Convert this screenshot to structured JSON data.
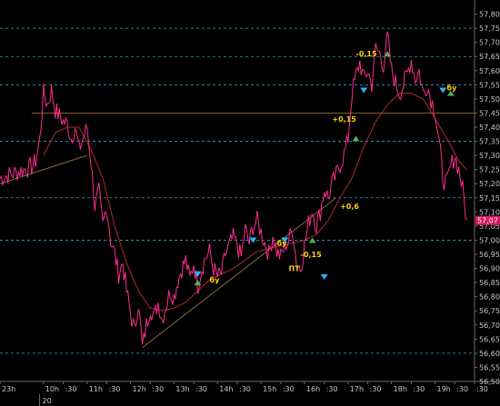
{
  "chart_data": {
    "type": "line",
    "title": "",
    "xlabel": "",
    "ylabel": "",
    "ylim": [
      56.5,
      57.85
    ],
    "grid": true,
    "y_ticks": [
      "57,80",
      "57,75",
      "57,70",
      "57,65",
      "57,60",
      "57,55",
      "57,50",
      "57,45",
      "57,40",
      "57,35",
      "57,30",
      "57,25",
      "57,20",
      "57,15",
      "57,10",
      "57,05",
      "57,00",
      "56,95",
      "56,90",
      "56,85",
      "56,80",
      "56,75",
      "56,70",
      "56,65",
      "56,60",
      "56,55",
      "56,50"
    ],
    "x_ticks": [
      {
        "label": "23h",
        "t": 0
      },
      {
        "label": "10h",
        "t": 11
      },
      {
        "label": ":30",
        "t": 16
      },
      {
        "label": "11h",
        "t": 22
      },
      {
        "label": ":30",
        "t": 27
      },
      {
        "label": "12h",
        "t": 33
      },
      {
        "label": ":30",
        "t": 38
      },
      {
        "label": "13h",
        "t": 44
      },
      {
        "label": ":30",
        "t": 49
      },
      {
        "label": "14h",
        "t": 55
      },
      {
        "label": ":30",
        "t": 60
      },
      {
        "label": "15h",
        "t": 66
      },
      {
        "label": ":30",
        "t": 71
      },
      {
        "label": "16h",
        "t": 77
      },
      {
        "label": ":30",
        "t": 82
      },
      {
        "label": "17h",
        "t": 88
      },
      {
        "label": ":30",
        "t": 93
      },
      {
        "label": "18h",
        "t": 99
      },
      {
        "label": ":30",
        "t": 104
      },
      {
        "label": "19h",
        "t": 110
      },
      {
        "label": ":30",
        "t": 115
      },
      {
        "label": ":30",
        "t": 120
      }
    ],
    "date_label": "20",
    "hlines": [
      57.75,
      57.65,
      57.55,
      57.35,
      57.15,
      57.0,
      56.6
    ],
    "level_line": 57.45,
    "price_series": {
      "t": [
        0,
        2,
        4,
        6,
        8,
        9,
        10,
        11,
        12,
        13,
        14,
        15,
        16,
        17,
        18,
        19,
        20,
        21,
        22,
        23,
        24,
        25,
        26,
        27,
        28,
        29,
        30,
        31,
        32,
        33,
        34,
        35,
        36,
        37,
        38,
        39,
        40,
        41,
        42,
        43,
        44,
        45,
        46,
        47,
        48,
        49,
        50,
        51,
        52,
        53,
        54,
        55,
        56,
        57,
        58,
        59,
        60,
        61,
        62,
        63,
        64,
        65,
        66,
        67,
        68,
        69,
        70,
        71,
        72,
        73,
        74,
        75,
        76,
        77,
        78,
        79,
        80,
        81,
        82,
        83,
        84,
        85,
        86,
        87,
        88,
        89,
        90,
        91,
        92,
        93,
        94,
        95,
        96,
        97,
        98,
        99,
        100,
        101,
        102,
        103,
        104,
        105,
        106,
        107,
        108,
        109,
        110,
        111,
        112,
        113,
        114,
        115,
        116,
        117,
        118
      ],
      "y": [
        57.22,
        57.23,
        57.24,
        57.25,
        57.26,
        57.28,
        57.35,
        57.52,
        57.48,
        57.53,
        57.46,
        57.44,
        57.42,
        57.41,
        57.36,
        57.4,
        57.32,
        57.36,
        57.4,
        57.28,
        57.12,
        57.17,
        57.05,
        57.12,
        57.0,
        56.95,
        56.88,
        56.92,
        56.82,
        56.74,
        56.68,
        56.78,
        56.62,
        56.7,
        56.76,
        56.73,
        56.78,
        56.72,
        56.77,
        56.82,
        56.8,
        56.86,
        56.9,
        56.93,
        56.86,
        56.92,
        56.84,
        56.9,
        56.94,
        56.96,
        56.9,
        56.87,
        56.88,
        56.95,
        56.98,
        57.01,
        56.98,
        56.94,
        57.04,
        56.99,
        57.05,
        57.07,
        57.03,
        56.99,
        56.95,
        57.02,
        56.96,
        56.94,
        56.98,
        57.0,
        57.04,
        56.92,
        56.9,
        56.98,
        57.06,
        57.11,
        57.05,
        57.1,
        57.18,
        57.15,
        57.2,
        57.23,
        57.27,
        57.3,
        57.36,
        57.52,
        57.58,
        57.63,
        57.57,
        57.6,
        57.55,
        57.68,
        57.66,
        57.62,
        57.72,
        57.6,
        57.56,
        57.52,
        57.55,
        57.59,
        57.64,
        57.57,
        57.6,
        57.52,
        57.55,
        57.5,
        57.46,
        57.35,
        57.22,
        57.2,
        57.26,
        57.3,
        57.25,
        57.18,
        57.07,
        57.03,
        57.0,
        57.05,
        57.07
      ]
    },
    "ma_series": {
      "t": [
        11,
        14,
        17,
        20,
        23,
        26,
        29,
        32,
        35,
        38,
        41,
        44,
        47,
        50,
        53,
        56,
        59,
        62,
        65,
        68,
        71,
        74,
        77,
        80,
        83,
        86,
        89,
        92,
        95,
        98,
        101,
        104,
        107,
        110,
        113,
        116,
        118
      ],
      "y": [
        57.3,
        57.38,
        57.4,
        57.4,
        57.32,
        57.22,
        57.05,
        56.92,
        56.82,
        56.76,
        56.75,
        56.76,
        56.78,
        56.82,
        56.86,
        56.88,
        56.9,
        56.93,
        56.96,
        56.97,
        56.98,
        56.99,
        57.0,
        57.02,
        57.07,
        57.15,
        57.22,
        57.33,
        57.42,
        57.48,
        57.52,
        57.52,
        57.5,
        57.43,
        57.36,
        57.28,
        57.25
      ]
    },
    "trend_lines": [
      {
        "t1": 0,
        "y1": 57.2,
        "t2": 22,
        "y2": 57.3
      },
      {
        "t1": 36,
        "y1": 56.62,
        "t2": 85,
        "y2": 57.15
      }
    ],
    "arrows_up": [
      {
        "t": 50,
        "y": 56.85
      },
      {
        "t": 79,
        "y": 57.0
      },
      {
        "t": 90,
        "y": 57.36
      },
      {
        "t": 98,
        "y": 57.66
      },
      {
        "t": 114,
        "y": 57.52
      }
    ],
    "arrows_down": [
      {
        "t": 50,
        "y": 56.88
      },
      {
        "t": 64,
        "y": 57.0
      },
      {
        "t": 72,
        "y": 57.0
      },
      {
        "t": 82,
        "y": 56.87
      },
      {
        "t": 92,
        "y": 57.53
      },
      {
        "t": 112,
        "y": 57.53
      }
    ],
    "annotations": [
      {
        "text": "бу",
        "t": 53,
        "y": 56.85
      },
      {
        "text": "бу",
        "t": 70,
        "y": 56.98
      },
      {
        "text": "ПТ",
        "t": 73,
        "y": 56.89
      },
      {
        "text": "-0,15",
        "t": 76,
        "y": 56.94
      },
      {
        "text": "+0,6",
        "t": 86,
        "y": 57.11
      },
      {
        "text": "+0,15",
        "t": 84,
        "y": 57.42
      },
      {
        "text": "-0,15",
        "t": 90,
        "y": 57.65
      },
      {
        "text": "бу",
        "t": 113,
        "y": 57.53
      }
    ],
    "last_price": "57,07",
    "colors": {
      "price": "#ff2d8f",
      "ma": "#a0282a",
      "trend": "#8a6a3c",
      "grid": "#2ba8c8",
      "level": "#8a5a2a",
      "arrow_up": "#4caf50",
      "arrow_down": "#29b6f6",
      "annotation": "#ffd200",
      "last_price_bg": "#d81b60"
    }
  }
}
